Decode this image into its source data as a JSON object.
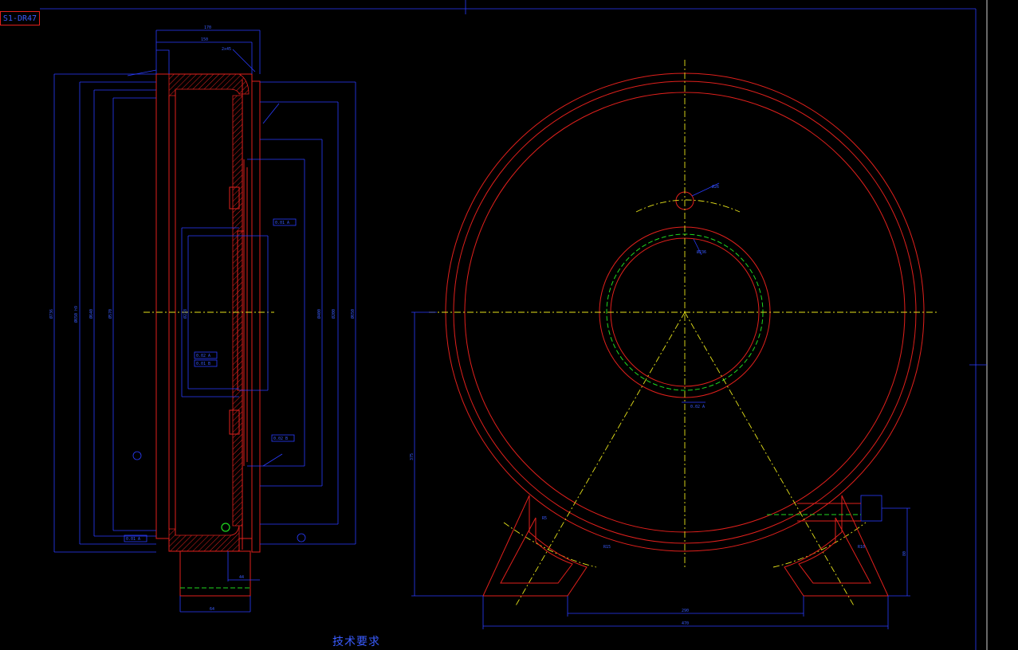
{
  "drawing_tag": "S1-DR47",
  "tech_requirements_title": "技术要求",
  "colors": {
    "background": "#000000",
    "outline": "#e0201c",
    "dimension": "#2a3cff",
    "centerline": "#e6e21a",
    "pitch": "#1fd91f"
  },
  "dimension_labels": {
    "top_width": "170",
    "top_inner": "150",
    "chamfer": "2x45",
    "dia_outer": "Ø736",
    "dia_2": "Ø650 h9",
    "dia_3": "Ø640",
    "dia_4": "Ø570",
    "dia_5": "Ø228",
    "dia_6": "Ø400",
    "dia_7": "Ø650",
    "bore": "Ø200",
    "tol_1": "0.01 A",
    "tol_2": "0.02 A",
    "tol_3": "0.01 B",
    "tol_4": "0.02 B",
    "hub_width": "64",
    "hub_len": "44",
    "height_center": "375",
    "base_width": "470",
    "base_inner": "290",
    "bolt_height": "80",
    "hole_dia": "Ø26",
    "radius_1": "R5",
    "radius_2": "R15",
    "radius_3": "R10",
    "pitch_dia": "Ø236"
  }
}
